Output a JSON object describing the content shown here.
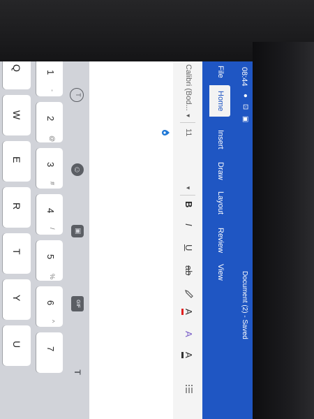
{
  "status_bar": {
    "time": "08:44",
    "icons": "● ⊡ ▣"
  },
  "word": {
    "document_title": "Document (2) - Saved",
    "tabs": [
      "File",
      "Home",
      "Insert",
      "Draw",
      "Layout",
      "Review",
      "View"
    ],
    "active_tab": "Home",
    "ribbon": {
      "font_name": "Calibri (Bod...",
      "font_size": "11",
      "bold": "B",
      "italic": "I",
      "underline": "U",
      "strikethrough": "ab",
      "highlight_icon": "pen-icon",
      "font_color": "A",
      "text_effects": "A",
      "styles": "A",
      "bullets_icon": "list-icon"
    },
    "accent_color": "#1f56c3"
  },
  "keyboard": {
    "numbers": [
      "1",
      "2",
      "3",
      "4",
      "5",
      "6",
      "7"
    ],
    "number_secondary": [
      "-",
      "@",
      "#",
      "/",
      "%",
      "^"
    ],
    "letters": [
      "Q",
      "W",
      "E",
      "R",
      "T",
      "Y",
      "U"
    ],
    "toolbar_icons": [
      "handwriting-icon",
      "emoji-icon",
      "sticker-icon",
      "gif-icon",
      "text-format-icon"
    ],
    "gif_label": "GIF"
  }
}
